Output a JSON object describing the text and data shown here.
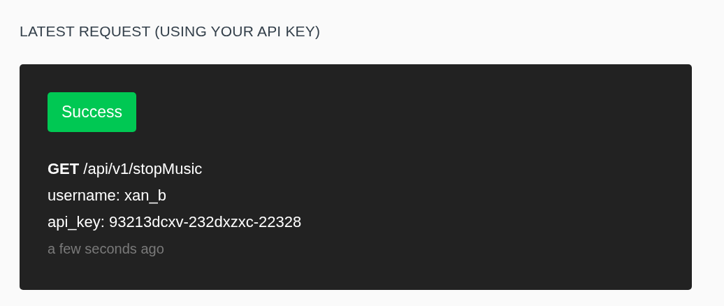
{
  "heading": "LATEST REQUEST (USING YOUR API KEY)",
  "request": {
    "status": {
      "kind": "success",
      "label": "Success"
    },
    "lines": [
      "**GET** /api/v1/stopMusic",
      "username: xan_b",
      "api_key: 93213dcxv-232dxzxc-22328"
    ],
    "time": "a few seconds ago"
  }
}
